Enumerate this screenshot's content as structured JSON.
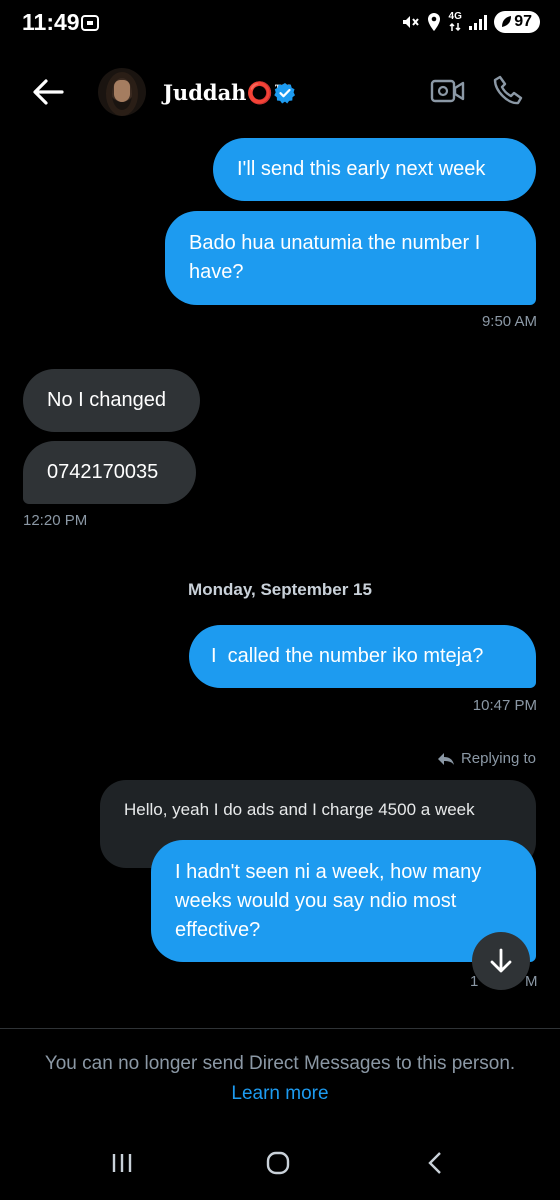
{
  "status_bar": {
    "time": "11:49",
    "network": "4G",
    "battery": "97"
  },
  "header": {
    "contact_name": "Juddah⭕™",
    "verified": true,
    "accent_color": "#1d9bf0"
  },
  "messages": [
    {
      "direction": "sent",
      "text": "I'll send this early next week"
    },
    {
      "direction": "sent",
      "text": "Bado hua unatumia the number I have?"
    },
    {
      "direction": "received",
      "text": "No I changed"
    },
    {
      "direction": "received",
      "text": "0742170035"
    },
    {
      "direction": "sent",
      "text": "I  called the number iko mteja?"
    },
    {
      "direction": "sent",
      "text": "I hadn't seen ni a week, how many weeks would you say ndio most effective?"
    }
  ],
  "timestamps": {
    "t1": "9:50 AM",
    "t2": "12:20 PM",
    "t3": "10:47 PM",
    "t4_partial_left": "1",
    "t4_partial_right": "M"
  },
  "date_separator": "Monday, September 15",
  "reply": {
    "label": "Replying to",
    "quoted_text": "Hello, yeah I do ads and I charge 4500 a week"
  },
  "footer": {
    "notice": "You can no longer send Direct Messages to this person.",
    "learn_more": "Learn more"
  },
  "colors": {
    "sent_bubble": "#1d9bf0",
    "received_bubble": "#2f3336",
    "background": "#000000",
    "muted_text": "#8b98a5"
  },
  "icons": [
    "back-arrow-icon",
    "verified-badge-icon",
    "video-call-icon",
    "phone-icon",
    "reply-arrow-icon",
    "arrow-down-icon",
    "recents-icon",
    "home-icon",
    "back-nav-icon"
  ]
}
